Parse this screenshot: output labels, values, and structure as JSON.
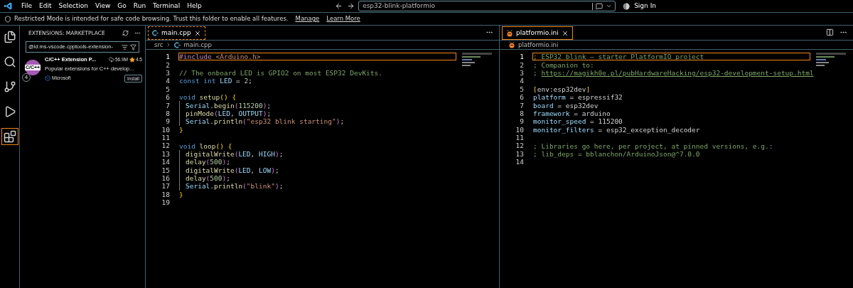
{
  "menu": [
    "File",
    "Edit",
    "Selection",
    "View",
    "Go",
    "Run",
    "Terminal",
    "Help"
  ],
  "command_center": {
    "value": "esp32-blink-platformio"
  },
  "account": {
    "label": "Sign In"
  },
  "banner": {
    "text": "Restricted Mode is intended for safe code browsing. Trust this folder to enable all features.",
    "links": [
      "Manage",
      "Learn More"
    ]
  },
  "activity_bar": [
    {
      "kind": "files",
      "selected": false
    },
    {
      "kind": "search",
      "selected": false
    },
    {
      "kind": "scm",
      "selected": false
    },
    {
      "kind": "run",
      "selected": false
    },
    {
      "kind": "extensions",
      "selected": true
    }
  ],
  "sidebar": {
    "title": "EXTENSIONS: MARKETPLACE",
    "search": {
      "value": "@id:ms-vscode.cpptools-extension-"
    },
    "extensions": [
      {
        "logo_text": "C/C++",
        "badge": "4",
        "name": "C/C++ Extension P...",
        "downloads": "56.9M",
        "rating": "4.5",
        "description": "Popular extensions for C++ develop...",
        "publisher": "Microsoft",
        "verified": true,
        "button": "Install"
      }
    ]
  },
  "editors": [
    {
      "tabs": [
        {
          "label": "main.cpp",
          "kind": "cpp",
          "selected": true,
          "focused": true
        }
      ],
      "breadcrumb": [
        "src",
        "main.cpp"
      ],
      "actions": [
        {
          "kind": "more"
        }
      ],
      "lines": [
        {
          "n": "1",
          "current": true,
          "guide": false,
          "tokens": [
            {
              "kind": "pre",
              "text": "#include "
            },
            {
              "kind": "str",
              "text": "<Arduino.h>"
            }
          ]
        },
        {
          "n": "2",
          "current": false,
          "guide": false
        },
        {
          "n": "3",
          "current": false,
          "guide": false,
          "tokens": [
            {
              "kind": "cmt",
              "text": "// The onboard LED is GPIO2 on most ESP32 DevKits."
            }
          ]
        },
        {
          "n": "4",
          "current": false,
          "guide": false,
          "tokens": [
            {
              "kind": "kw",
              "text": "const int "
            },
            {
              "kind": "var",
              "text": "LED"
            },
            {
              "kind": "p",
              "text": " = "
            },
            {
              "kind": "num",
              "text": "2"
            },
            {
              "kind": "p",
              "text": ";"
            }
          ]
        },
        {
          "n": "5",
          "current": false,
          "guide": false
        },
        {
          "n": "6",
          "current": false,
          "guide": false,
          "tokens": [
            {
              "kind": "kw",
              "text": "void "
            },
            {
              "kind": "fn",
              "text": "setup"
            },
            {
              "kind": "br",
              "text": "() {"
            }
          ]
        },
        {
          "n": "7",
          "current": false,
          "guide": true,
          "tokens": [
            {
              "kind": "var",
              "text": "Serial"
            },
            {
              "kind": "p",
              "text": "."
            },
            {
              "kind": "fn",
              "text": "begin"
            },
            {
              "kind": "br2",
              "text": "("
            },
            {
              "kind": "num",
              "text": "115200"
            },
            {
              "kind": "br2",
              "text": ")"
            },
            {
              "kind": "p",
              "text": ";"
            }
          ]
        },
        {
          "n": "8",
          "current": false,
          "guide": true,
          "tokens": [
            {
              "kind": "fn",
              "text": "pinMode"
            },
            {
              "kind": "br2",
              "text": "("
            },
            {
              "kind": "var",
              "text": "LED"
            },
            {
              "kind": "p",
              "text": ", "
            },
            {
              "kind": "var",
              "text": "OUTPUT"
            },
            {
              "kind": "br2",
              "text": ")"
            },
            {
              "kind": "p",
              "text": ";"
            }
          ]
        },
        {
          "n": "9",
          "current": false,
          "guide": true,
          "tokens": [
            {
              "kind": "var",
              "text": "Serial"
            },
            {
              "kind": "p",
              "text": "."
            },
            {
              "kind": "fn",
              "text": "println"
            },
            {
              "kind": "br2",
              "text": "("
            },
            {
              "kind": "str",
              "text": "\"esp32 blink starting\""
            },
            {
              "kind": "br2",
              "text": ")"
            },
            {
              "kind": "p",
              "text": ";"
            }
          ]
        },
        {
          "n": "10",
          "current": false,
          "guide": false,
          "tokens": [
            {
              "kind": "br",
              "text": "}"
            }
          ]
        },
        {
          "n": "11",
          "current": false,
          "guide": false
        },
        {
          "n": "12",
          "current": false,
          "guide": false,
          "tokens": [
            {
              "kind": "kw",
              "text": "void "
            },
            {
              "kind": "fn",
              "text": "loop"
            },
            {
              "kind": "br",
              "text": "() {"
            }
          ]
        },
        {
          "n": "13",
          "current": false,
          "guide": true,
          "tokens": [
            {
              "kind": "fn",
              "text": "digitalWrite"
            },
            {
              "kind": "br2",
              "text": "("
            },
            {
              "kind": "var",
              "text": "LED"
            },
            {
              "kind": "p",
              "text": ", "
            },
            {
              "kind": "var",
              "text": "HIGH"
            },
            {
              "kind": "br2",
              "text": ")"
            },
            {
              "kind": "p",
              "text": ";"
            }
          ]
        },
        {
          "n": "14",
          "current": false,
          "guide": true,
          "tokens": [
            {
              "kind": "fn",
              "text": "delay"
            },
            {
              "kind": "br2",
              "text": "("
            },
            {
              "kind": "num",
              "text": "500"
            },
            {
              "kind": "br2",
              "text": ")"
            },
            {
              "kind": "p",
              "text": ";"
            }
          ]
        },
        {
          "n": "15",
          "current": false,
          "guide": true,
          "tokens": [
            {
              "kind": "fn",
              "text": "digitalWrite"
            },
            {
              "kind": "br2",
              "text": "("
            },
            {
              "kind": "var",
              "text": "LED"
            },
            {
              "kind": "p",
              "text": ", "
            },
            {
              "kind": "var",
              "text": "LOW"
            },
            {
              "kind": "br2",
              "text": ")"
            },
            {
              "kind": "p",
              "text": ";"
            }
          ]
        },
        {
          "n": "16",
          "current": false,
          "guide": true,
          "tokens": [
            {
              "kind": "fn",
              "text": "delay"
            },
            {
              "kind": "br2",
              "text": "("
            },
            {
              "kind": "num",
              "text": "500"
            },
            {
              "kind": "br2",
              "text": ")"
            },
            {
              "kind": "p",
              "text": ";"
            }
          ]
        },
        {
          "n": "17",
          "current": false,
          "guide": true,
          "tokens": [
            {
              "kind": "var",
              "text": "Serial"
            },
            {
              "kind": "p",
              "text": "."
            },
            {
              "kind": "fn",
              "text": "println"
            },
            {
              "kind": "br2",
              "text": "("
            },
            {
              "kind": "str",
              "text": "\"blink\""
            },
            {
              "kind": "br2",
              "text": ")"
            },
            {
              "kind": "p",
              "text": ";"
            }
          ]
        },
        {
          "n": "18",
          "current": false,
          "guide": false,
          "tokens": [
            {
              "kind": "br",
              "text": "}"
            }
          ]
        },
        {
          "n": "19",
          "current": false,
          "guide": false
        }
      ]
    },
    {
      "tabs": [
        {
          "label": "platformio.ini",
          "kind": "ini",
          "selected": true,
          "focused": false
        }
      ],
      "breadcrumb": [
        "platformio.ini"
      ],
      "actions": [
        {
          "kind": "split"
        },
        {
          "kind": "more"
        }
      ],
      "lines": [
        {
          "n": "1",
          "current": true,
          "guide": false,
          "tokens": [
            {
              "kind": "cmt",
              "text": "; ESP32 blink – starter PlatformIO project"
            }
          ]
        },
        {
          "n": "2",
          "current": false,
          "guide": false,
          "tokens": [
            {
              "kind": "cmt",
              "text": "; Companion to:"
            }
          ]
        },
        {
          "n": "3",
          "current": false,
          "guide": false,
          "tokens": [
            {
              "kind": "cmt",
              "text": "; "
            },
            {
              "kind": "link",
              "text": "https://magikh0e.pl/pubHardwareHacking/esp32-development-setup.html"
            }
          ]
        },
        {
          "n": "4",
          "current": false,
          "guide": false
        },
        {
          "n": "5",
          "current": false,
          "guide": false,
          "tokens": [
            {
              "kind": "br",
              "text": "["
            },
            {
              "kind": "p",
              "text": "env:esp32dev"
            },
            {
              "kind": "br",
              "text": "]"
            }
          ]
        },
        {
          "n": "6",
          "current": false,
          "guide": false,
          "tokens": [
            {
              "kind": "var",
              "text": "platform"
            },
            {
              "kind": "p",
              "text": " = espressif32"
            }
          ]
        },
        {
          "n": "7",
          "current": false,
          "guide": false,
          "tokens": [
            {
              "kind": "var",
              "text": "board"
            },
            {
              "kind": "p",
              "text": " = esp32dev"
            }
          ]
        },
        {
          "n": "8",
          "current": false,
          "guide": false,
          "tokens": [
            {
              "kind": "var",
              "text": "framework"
            },
            {
              "kind": "p",
              "text": " = arduino"
            }
          ]
        },
        {
          "n": "9",
          "current": false,
          "guide": false,
          "tokens": [
            {
              "kind": "var",
              "text": "monitor_speed"
            },
            {
              "kind": "p",
              "text": " = 115200"
            }
          ]
        },
        {
          "n": "10",
          "current": false,
          "guide": false,
          "tokens": [
            {
              "kind": "var",
              "text": "monitor_filters"
            },
            {
              "kind": "p",
              "text": " = esp32_exception_decoder"
            }
          ]
        },
        {
          "n": "11",
          "current": false,
          "guide": false
        },
        {
          "n": "12",
          "current": false,
          "guide": false,
          "tokens": [
            {
              "kind": "cmt",
              "text": "; Libraries go here, per project, at pinned versions, e.g.:"
            }
          ]
        },
        {
          "n": "13",
          "current": false,
          "guide": false,
          "tokens": [
            {
              "kind": "cmt",
              "text": "; lib_deps = bblanchon/ArduinoJson@^7.0.0"
            }
          ]
        },
        {
          "n": "14",
          "current": false,
          "guide": false
        }
      ]
    }
  ]
}
